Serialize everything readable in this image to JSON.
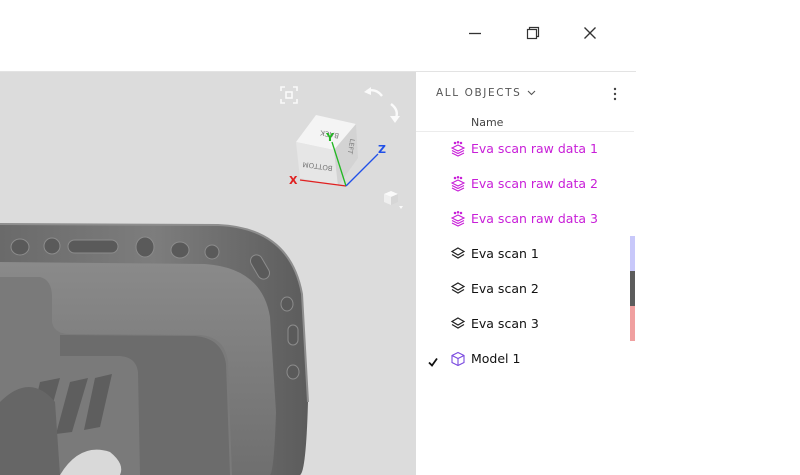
{
  "window": {
    "minimize_icon": "minimize-icon",
    "restore_icon": "restore-icon",
    "close_icon": "close-icon"
  },
  "viewport": {
    "cube_faces": {
      "top": "BACK",
      "front": "BOTTOM",
      "side": "LEFT"
    },
    "axes": {
      "x": "X",
      "y": "Y",
      "z": "Z"
    },
    "axis_colors": {
      "x": "#e02020",
      "y": "#22b822",
      "z": "#2050e8"
    },
    "icons": [
      "fit-view-icon",
      "rotate-left-icon",
      "rotate-right-icon",
      "view-cube-icon"
    ]
  },
  "panel": {
    "header": "ALL OBJECTS",
    "column_header": "Name",
    "accent_color": "#c81ed8",
    "objects": [
      {
        "label": "Eva scan raw data 1",
        "icon": "raw-scan-icon",
        "checked": false
      },
      {
        "label": "Eva scan raw data 2",
        "icon": "raw-scan-icon",
        "checked": false
      },
      {
        "label": "Eva scan raw data 3",
        "icon": "raw-scan-icon",
        "checked": false
      },
      {
        "label": "Eva scan 1",
        "icon": "scan-layers-icon",
        "checked": false,
        "swatch": "#c8c8fa"
      },
      {
        "label": "Eva scan 2",
        "icon": "scan-layers-icon",
        "checked": false,
        "swatch": "#5c5c5c"
      },
      {
        "label": "Eva scan 3",
        "icon": "scan-layers-icon",
        "checked": false,
        "swatch": "#f0a0a0"
      },
      {
        "label": "Model 1",
        "icon": "model-cube-icon",
        "checked": true
      }
    ]
  }
}
